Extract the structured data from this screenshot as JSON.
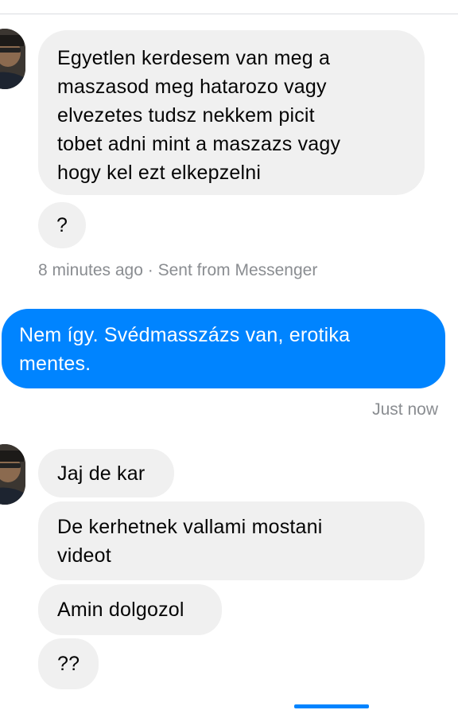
{
  "thread": {
    "incoming_1": {
      "message": "Egyetlen kerdesem van meg a maszasod meg hatarozo vagy elvezetes tudsz nekkem picit tobet adni mint a maszazs vagy hogy kel ezt elkepzelni",
      "lines": [
        "Egyetlen kerdesem van meg a",
        "maszasod meg hatarozo vagy",
        "elvezetes tudsz nekkem picit",
        "tobet adni mint a maszazs vagy",
        "hogy kel ezt elkepzelni"
      ],
      "followup": "?",
      "meta": "8 minutes ago · Sent from Messenger"
    },
    "outgoing_1": {
      "message": "Nem így. Svédmasszázs van, erotika mentes.",
      "lines": [
        "Nem így. Svédmasszázs van, erotika",
        "mentes."
      ],
      "meta": "Just now"
    },
    "incoming_2": {
      "messages": [
        {
          "lines": [
            "Jaj de kar"
          ]
        },
        {
          "lines": [
            "De kerhetnek vallami mostani",
            "videot"
          ]
        },
        {
          "lines": [
            "Amin dolgozol"
          ]
        },
        {
          "lines": [
            "??"
          ]
        }
      ]
    }
  },
  "colors": {
    "incoming_bubble": "#f0f0f0",
    "outgoing_bubble": "#0084ff",
    "meta_text": "#8a8d91"
  },
  "icons": {
    "avatar": "avatar"
  }
}
